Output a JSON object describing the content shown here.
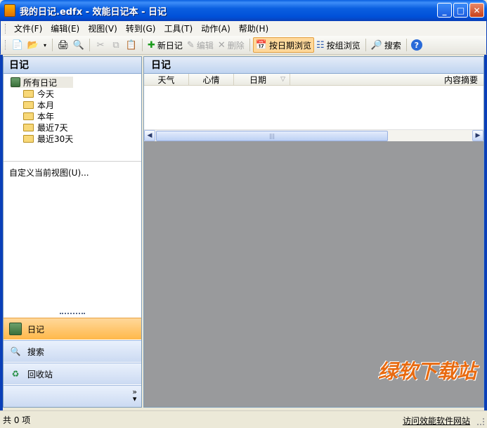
{
  "window": {
    "title": "我的日记.edfx - 效能日记本 - 日记"
  },
  "menu": [
    "文件(F)",
    "编辑(E)",
    "视图(V)",
    "转到(G)",
    "工具(T)",
    "动作(A)",
    "帮助(H)"
  ],
  "toolbar": {
    "new_diary": "新日记",
    "edit": "编辑",
    "delete": "删除",
    "browse_by_date": "按日期浏览",
    "browse_by_group": "按组浏览",
    "search": "搜索"
  },
  "left_panel": {
    "header": "日记",
    "tree_root": "所有日记",
    "tree_items": [
      "今天",
      "本月",
      "本年",
      "最近7天",
      "最近30天"
    ],
    "customize_link": "自定义当前视图(U)..."
  },
  "nav": {
    "diary": "日记",
    "search": "搜索",
    "recycle": "回收站"
  },
  "right_panel": {
    "header": "日记",
    "columns": [
      "天气",
      "心情",
      "日期",
      "内容摘要"
    ]
  },
  "status": {
    "count_text": "共 0 项",
    "link_text": "访问效能软件网站"
  },
  "watermark": "绿软下载站",
  "colors": {
    "title_bar": "#0a5fe0",
    "active_nav": "#ffb84a",
    "content_bg": "#999a9c"
  }
}
